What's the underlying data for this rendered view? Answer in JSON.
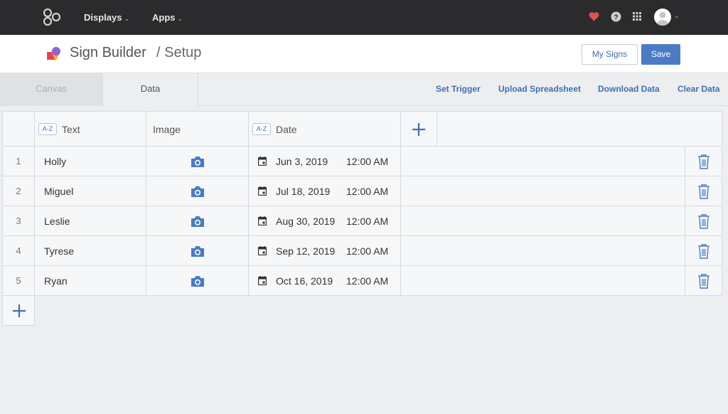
{
  "nav": {
    "displays_label": "Displays",
    "apps_label": "Apps",
    "caret": "⌄"
  },
  "header": {
    "title": "Sign Builder",
    "subtitle": "/ Setup",
    "my_signs_label": "My Signs",
    "save_label": "Save"
  },
  "tabs": {
    "canvas_label": "Canvas",
    "data_label": "Data"
  },
  "actions": {
    "set_trigger": "Set Trigger",
    "upload_spreadsheet": "Upload Spreadsheet",
    "download_data": "Download Data",
    "clear_data": "Clear Data"
  },
  "table": {
    "columns": [
      {
        "badge": "A-Z",
        "label": "Text"
      },
      {
        "badge": "",
        "label": "Image"
      },
      {
        "badge": "A-Z",
        "label": "Date"
      }
    ],
    "rows": [
      {
        "num": "1",
        "text": "Holly",
        "date": "Jun 3, 2019",
        "time": "12:00 AM"
      },
      {
        "num": "2",
        "text": "Miguel",
        "date": "Jul 18, 2019",
        "time": "12:00 AM"
      },
      {
        "num": "3",
        "text": "Leslie",
        "date": "Aug 30, 2019",
        "time": "12:00 AM"
      },
      {
        "num": "4",
        "text": "Tyrese",
        "date": "Sep 12, 2019",
        "time": "12:00 AM"
      },
      {
        "num": "5",
        "text": "Ryan",
        "date": "Oct 16, 2019",
        "time": "12:00 AM"
      }
    ]
  },
  "colors": {
    "accent": "#4a7cc6",
    "link": "#3f6fb6",
    "nav_bg": "#2b2b2d",
    "heart": "#d9534f"
  },
  "icons": [
    "logo-icon",
    "heart-icon",
    "help-icon",
    "apps-grid-icon",
    "avatar",
    "camera-icon",
    "calendar-icon",
    "trash-icon",
    "plus-icon"
  ]
}
